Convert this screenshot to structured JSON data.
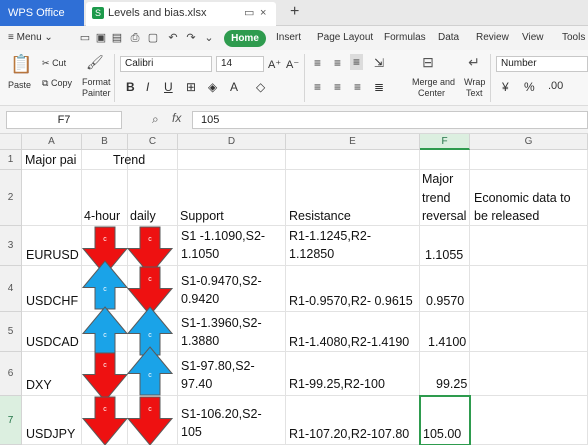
{
  "app": {
    "name": "WPS Office"
  },
  "file_tab": {
    "name": "Levels and bias.xlsx"
  },
  "menu": {
    "label": "Menu"
  },
  "ribbon_tabs": [
    "Home",
    "Insert",
    "Page Layout",
    "Formulas",
    "Data",
    "Review",
    "View",
    "Tools"
  ],
  "ribbon": {
    "paste": "Paste",
    "cut": "Cut",
    "copy": "Copy",
    "format_painter_1": "Format",
    "format_painter_2": "Painter",
    "font_name": "Calibri",
    "font_size": "14",
    "merge_center_1": "Merge and",
    "merge_center_2": "Center",
    "wrap_text_1": "Wrap",
    "wrap_text_2": "Text",
    "number_format": "Number"
  },
  "formula_bar": {
    "cell_ref": "F7",
    "fx": "fx",
    "value": "105"
  },
  "columns": [
    "A",
    "B",
    "C",
    "D",
    "E",
    "F",
    "G"
  ],
  "rows": [
    "1",
    "2",
    "3",
    "4",
    "5",
    "6",
    "7"
  ],
  "sheet": {
    "r1": {
      "a": "Major pai",
      "bc": "Trend"
    },
    "r2": {
      "b": "4-hour",
      "c": "daily",
      "d": "Support",
      "e": "Resistance",
      "f1": "Major",
      "f2": "trend",
      "f3": "reversal",
      "g1": "Economic data to",
      "g2": "be released"
    },
    "r3": {
      "a": "EURUSD",
      "d1": "S1 -1.1090,S2-",
      "d2": "1.1050",
      "e1": "R1-1.1245,R2-",
      "e2": "1.12850",
      "f": "1.1055"
    },
    "r4": {
      "a": "USDCHF",
      "d1": "S1-0.9470,S2-",
      "d2": "0.9420",
      "e": "R1-0.9570,R2- 0.9615",
      "f": "0.9570"
    },
    "r5": {
      "a": "USDCAD",
      "d1": "S1-1.3960,S2-",
      "d2": "1.3880",
      "e": "R1-1.4080,R2-1.4190",
      "f": "1.4100"
    },
    "r6": {
      "a": "DXY",
      "d1": "S1-97.80,S2-",
      "d2": "97.40",
      "e": "R1-99.25,R2-100",
      "f": "99.25"
    },
    "r7": {
      "a": "USDJPY",
      "d1": "S1-106.20,S2-",
      "d2": "105",
      "e": "R1-107.20,R2-107.80",
      "f": "105.00"
    }
  },
  "arrow_label": "c",
  "trend_arrows": [
    [
      "down",
      "down"
    ],
    [
      "up",
      "down"
    ],
    [
      "up",
      "up"
    ],
    [
      "down",
      "up"
    ],
    [
      "down",
      "down"
    ]
  ],
  "colors": {
    "down": "#ee1111",
    "up": "#1aa3e8",
    "accent": "#2e9b4e",
    "title_blue": "#2f6fd6"
  }
}
